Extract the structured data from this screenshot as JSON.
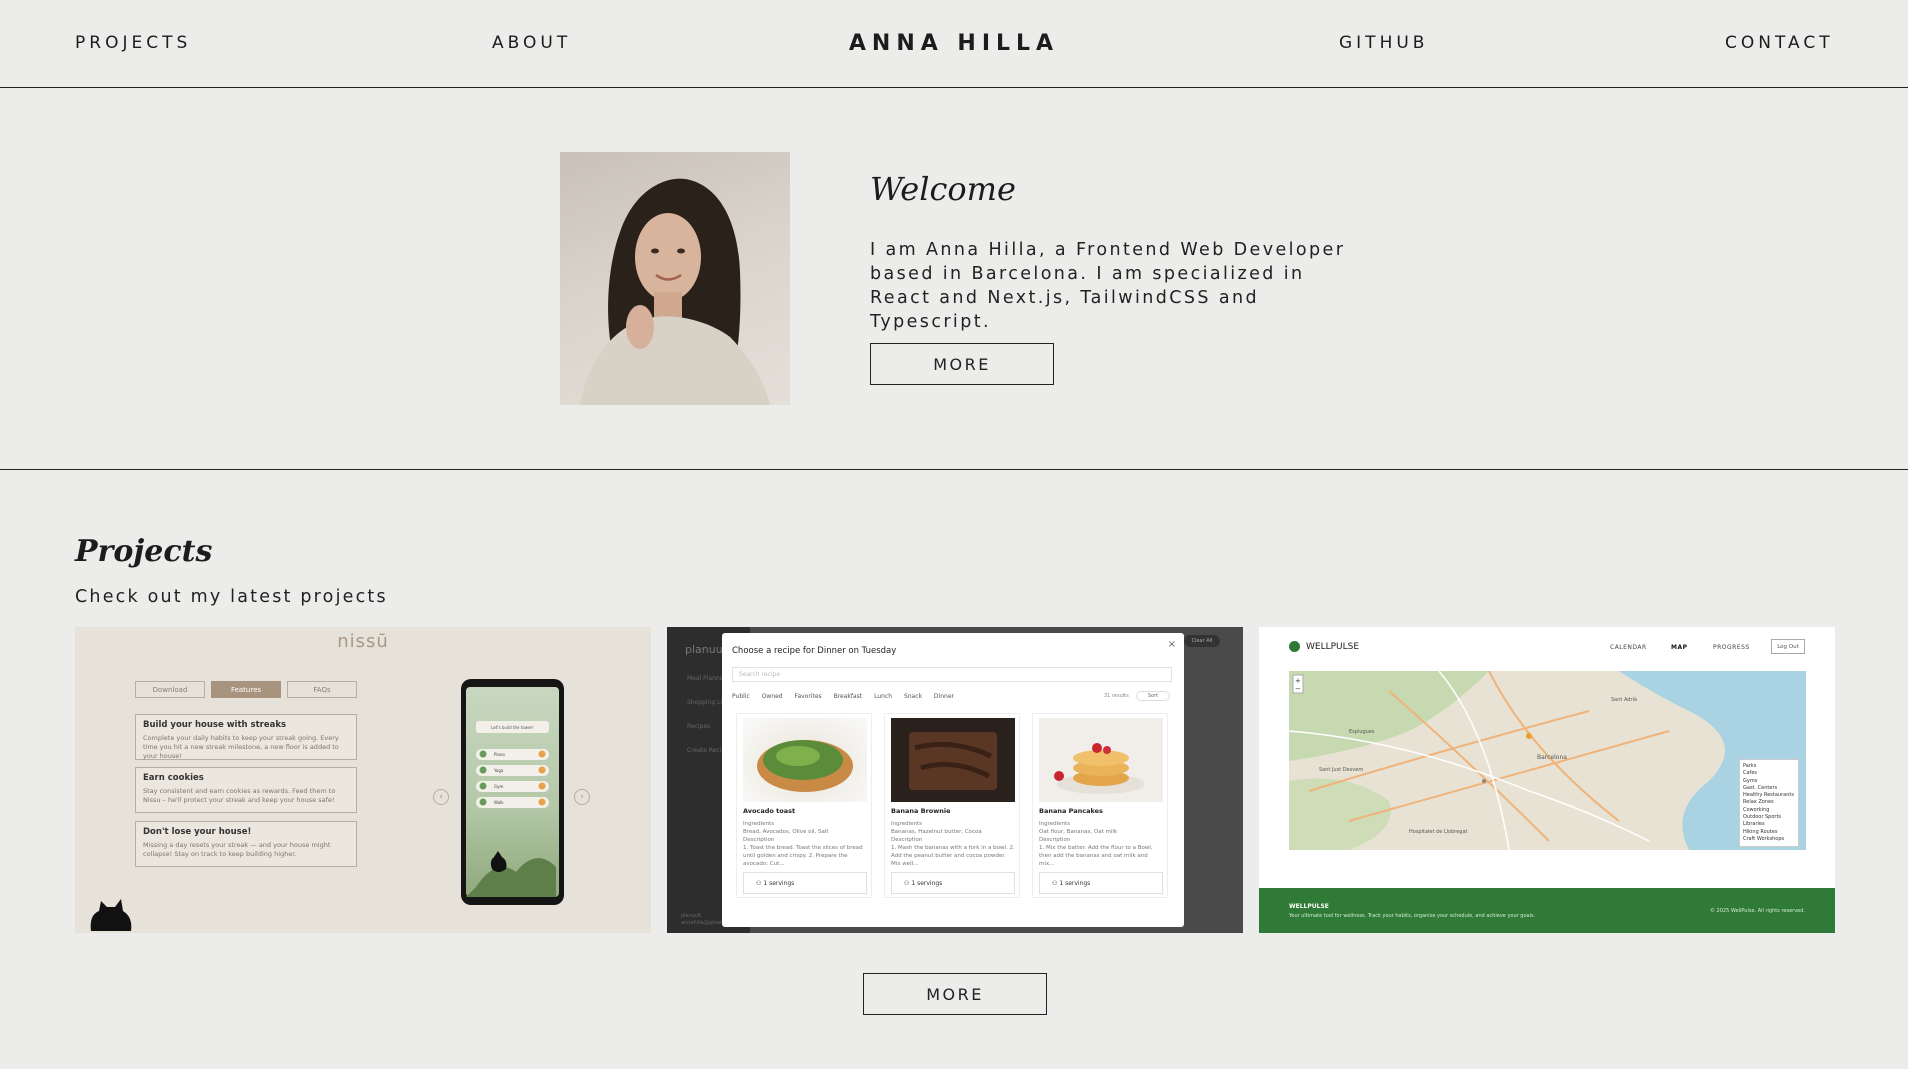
{
  "nav": {
    "projects": "PROJECTS",
    "about": "ABOUT",
    "logo": "ANNA HILLA",
    "github": "GITHUB",
    "contact": "CONTACT"
  },
  "hero": {
    "title": "Welcome",
    "text": "I am Anna Hilla, a Frontend Web Developer based in Barcelona. I am specialized in React and Next.js, TailwindCSS and Typescript.",
    "button": "MORE"
  },
  "projects": {
    "title": "Projects",
    "subtitle": "Check out my latest projects",
    "button": "MORE",
    "cards": [
      {
        "brand": "nissū",
        "tabs": [
          "Download",
          "Features",
          "FAQs"
        ],
        "features": [
          {
            "title": "Build your house with streaks",
            "text": "Complete your daily habits to keep your streak going. Every time you hit a new streak milestone, a new floor is added to your house!"
          },
          {
            "title": "Earn cookies",
            "text": "Stay consistent and earn cookies as rewards. Feed them to Nissu – he'll protect your streak and keep your house safe!"
          },
          {
            "title": "Don't lose your house!",
            "text": "Missing a day resets your streak — and your house might collapse! Stay on track to keep building higher."
          }
        ],
        "phone_heading": "Let's build the tower!",
        "phone_items": [
          "Piano",
          "Yoga",
          "Gym",
          "Walk"
        ]
      },
      {
        "brand": "planuu",
        "sidebar": [
          "Meal Planner",
          "Shopping List",
          "Recipes",
          "Create Recipe"
        ],
        "modal_title": "Choose a recipe for Dinner on Tuesday",
        "search_placeholder": "Search recipe",
        "filters": [
          "Public",
          "Owned",
          "Favorites",
          "Breakfast",
          "Lunch",
          "Snack",
          "Dinner"
        ],
        "results": "31 results",
        "sort": "Sort",
        "clear_all": "Clear All",
        "close": "×",
        "recipes": [
          {
            "name": "Avocado toast",
            "ingredients": "Bread, Avocados, Olive oil, Salt",
            "description": "1. Toast the bread. Toast the slices of bread until golden and crispy. 2. Prepare the avocado: Cut...",
            "servings": "1"
          },
          {
            "name": "Banana Brownie",
            "ingredients": "Bananas, Hazelnut butter, Cocoa",
            "description": "1. Mash the bananas with a fork in a bowl. 2. Add the peanut butter and cocoa powder. Mix well...",
            "servings": "1"
          },
          {
            "name": "Banana Pancakes",
            "ingredients": "Oat flour, Bananas, Oat milk",
            "description": "1. Mix the batter. Add the flour to a Bowl, then add the bananas and oat milk and mix...",
            "servings": "1"
          }
        ],
        "labels": {
          "ingredients": "Ingredients",
          "description": "Description",
          "servings": "servings"
        },
        "user": "planuu6",
        "user_email": "annahilla@gmail.com"
      },
      {
        "brand": "WELLPULSE",
        "nav": [
          "CALENDAR",
          "MAP",
          "PROGRESS"
        ],
        "logout": "Log Out",
        "legend": [
          "Parks",
          "Cafes",
          "Gyms",
          "Gast. Centers",
          "Healthy Restaurants",
          "Relax Zones",
          "Coworking",
          "Outdoor Sports",
          "Libraries",
          "Hiking Routes",
          "Craft Workshops"
        ],
        "map_labels": [
          "Barcelona",
          "Sant Adrià",
          "Hospitalet de Llobregat",
          "Sant Just Desvern",
          "Esplugues"
        ],
        "footer_title": "WELLPULSE",
        "footer_text": "Your ultimate tool for wellness. Track your habits, organize your schedule, and achieve your goals.",
        "footer_copy": "© 2025 WellPulse. All rights reserved."
      }
    ]
  },
  "colors": {
    "background": "#ececeb",
    "text": "#1c1c1c",
    "wellpulse_green": "#2f7a36",
    "nissu_accent": "#a89784"
  }
}
